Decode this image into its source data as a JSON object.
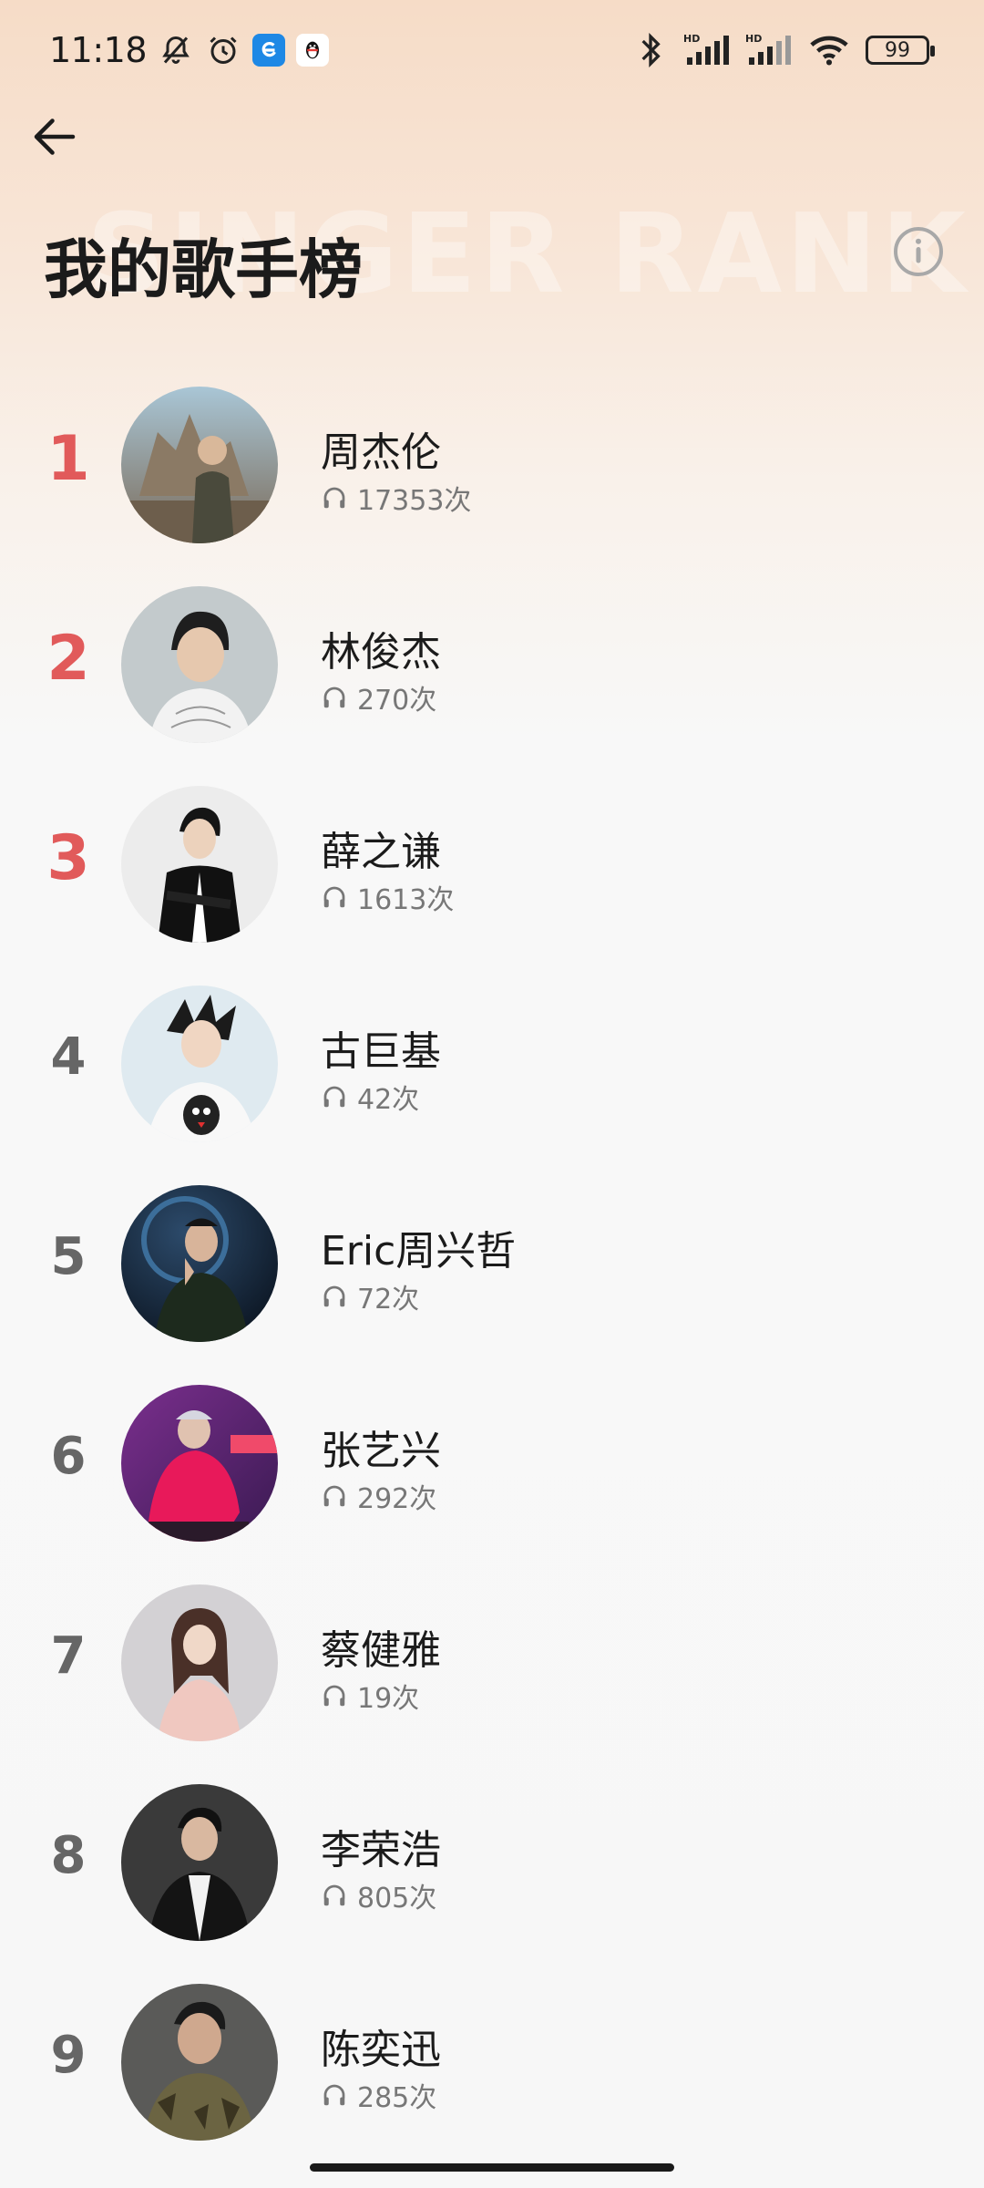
{
  "status_bar": {
    "time": "11:18",
    "battery": "99"
  },
  "header": {
    "title": "我的歌手榜",
    "watermark": "SINGER RANK"
  },
  "colors": {
    "accent_rank": "#e15a5a",
    "rank_default": "#666666",
    "text_primary": "#1b1b1b",
    "text_secondary": "#777777"
  },
  "singers": [
    {
      "rank": "1",
      "name": "周杰伦",
      "plays": "17353次"
    },
    {
      "rank": "2",
      "name": "林俊杰",
      "plays": "270次"
    },
    {
      "rank": "3",
      "name": "薛之谦",
      "plays": "1613次"
    },
    {
      "rank": "4",
      "name": "古巨基",
      "plays": "42次"
    },
    {
      "rank": "5",
      "name": "Eric周兴哲",
      "plays": "72次"
    },
    {
      "rank": "6",
      "name": "张艺兴",
      "plays": "292次"
    },
    {
      "rank": "7",
      "name": "蔡健雅",
      "plays": "19次"
    },
    {
      "rank": "8",
      "name": "李荣浩",
      "plays": "805次"
    },
    {
      "rank": "9",
      "name": "陈奕迅",
      "plays": "285次"
    }
  ]
}
